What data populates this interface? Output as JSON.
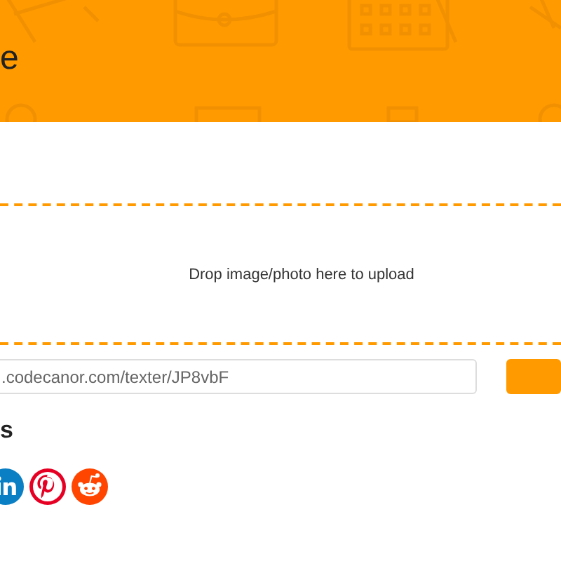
{
  "header": {
    "title": "e"
  },
  "dropzone": {
    "text": "Drop image/photo here to upload"
  },
  "link": {
    "value": ".codecanor.com/texter/JP8vbF"
  },
  "share": {
    "heading": "s",
    "networks": [
      {
        "kind": "linkedin"
      },
      {
        "kind": "pinterest"
      },
      {
        "kind": "reddit"
      }
    ]
  }
}
